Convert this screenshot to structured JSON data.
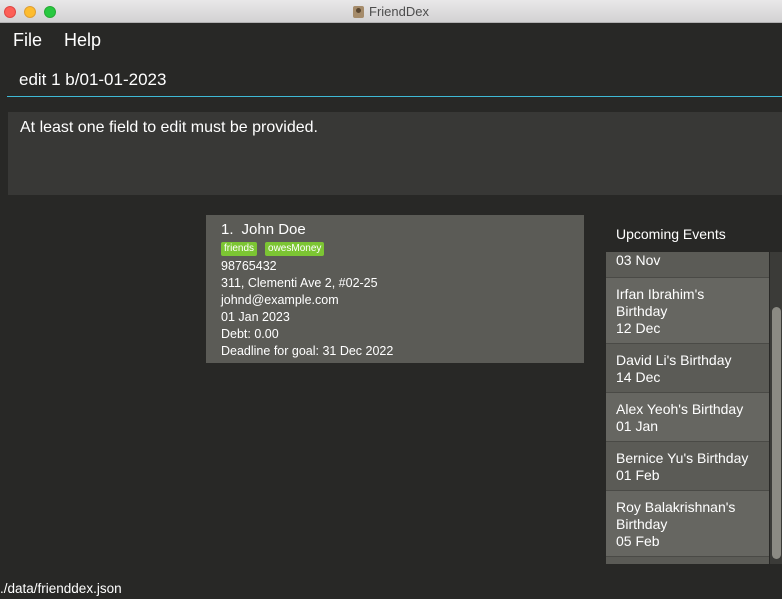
{
  "window": {
    "title": "FriendDex"
  },
  "menu": {
    "file": "File",
    "help": "Help"
  },
  "command": {
    "value": "edit 1 b/01-01-2023"
  },
  "result": {
    "message": "At least one field to edit must be provided."
  },
  "person": {
    "index": "1.",
    "name": "John Doe",
    "tags": [
      "friends",
      "owesMoney"
    ],
    "phone": "98765432",
    "address": "311, Clementi Ave 2, #02-25",
    "email": "johnd@example.com",
    "birthday": "01 Jan 2023",
    "debt": "Debt: 0.00",
    "goal": "Deadline for goal: 31 Dec 2022"
  },
  "events": {
    "title": "Upcoming Events",
    "items": [
      {
        "name": "",
        "date": "03 Nov"
      },
      {
        "name": "Irfan Ibrahim's Birthday",
        "date": "12 Dec"
      },
      {
        "name": "David Li's Birthday",
        "date": "14 Dec"
      },
      {
        "name": "Alex Yeoh's Birthday",
        "date": "01 Jan"
      },
      {
        "name": "Bernice Yu's Birthday",
        "date": "01 Feb"
      },
      {
        "name": "Roy Balakrishnan's Birthday",
        "date": "05 Feb"
      }
    ]
  },
  "status": {
    "path": "./data/frienddex.json"
  },
  "colors": {
    "accent": "#3fb9d5",
    "tag": "#7cc533"
  }
}
